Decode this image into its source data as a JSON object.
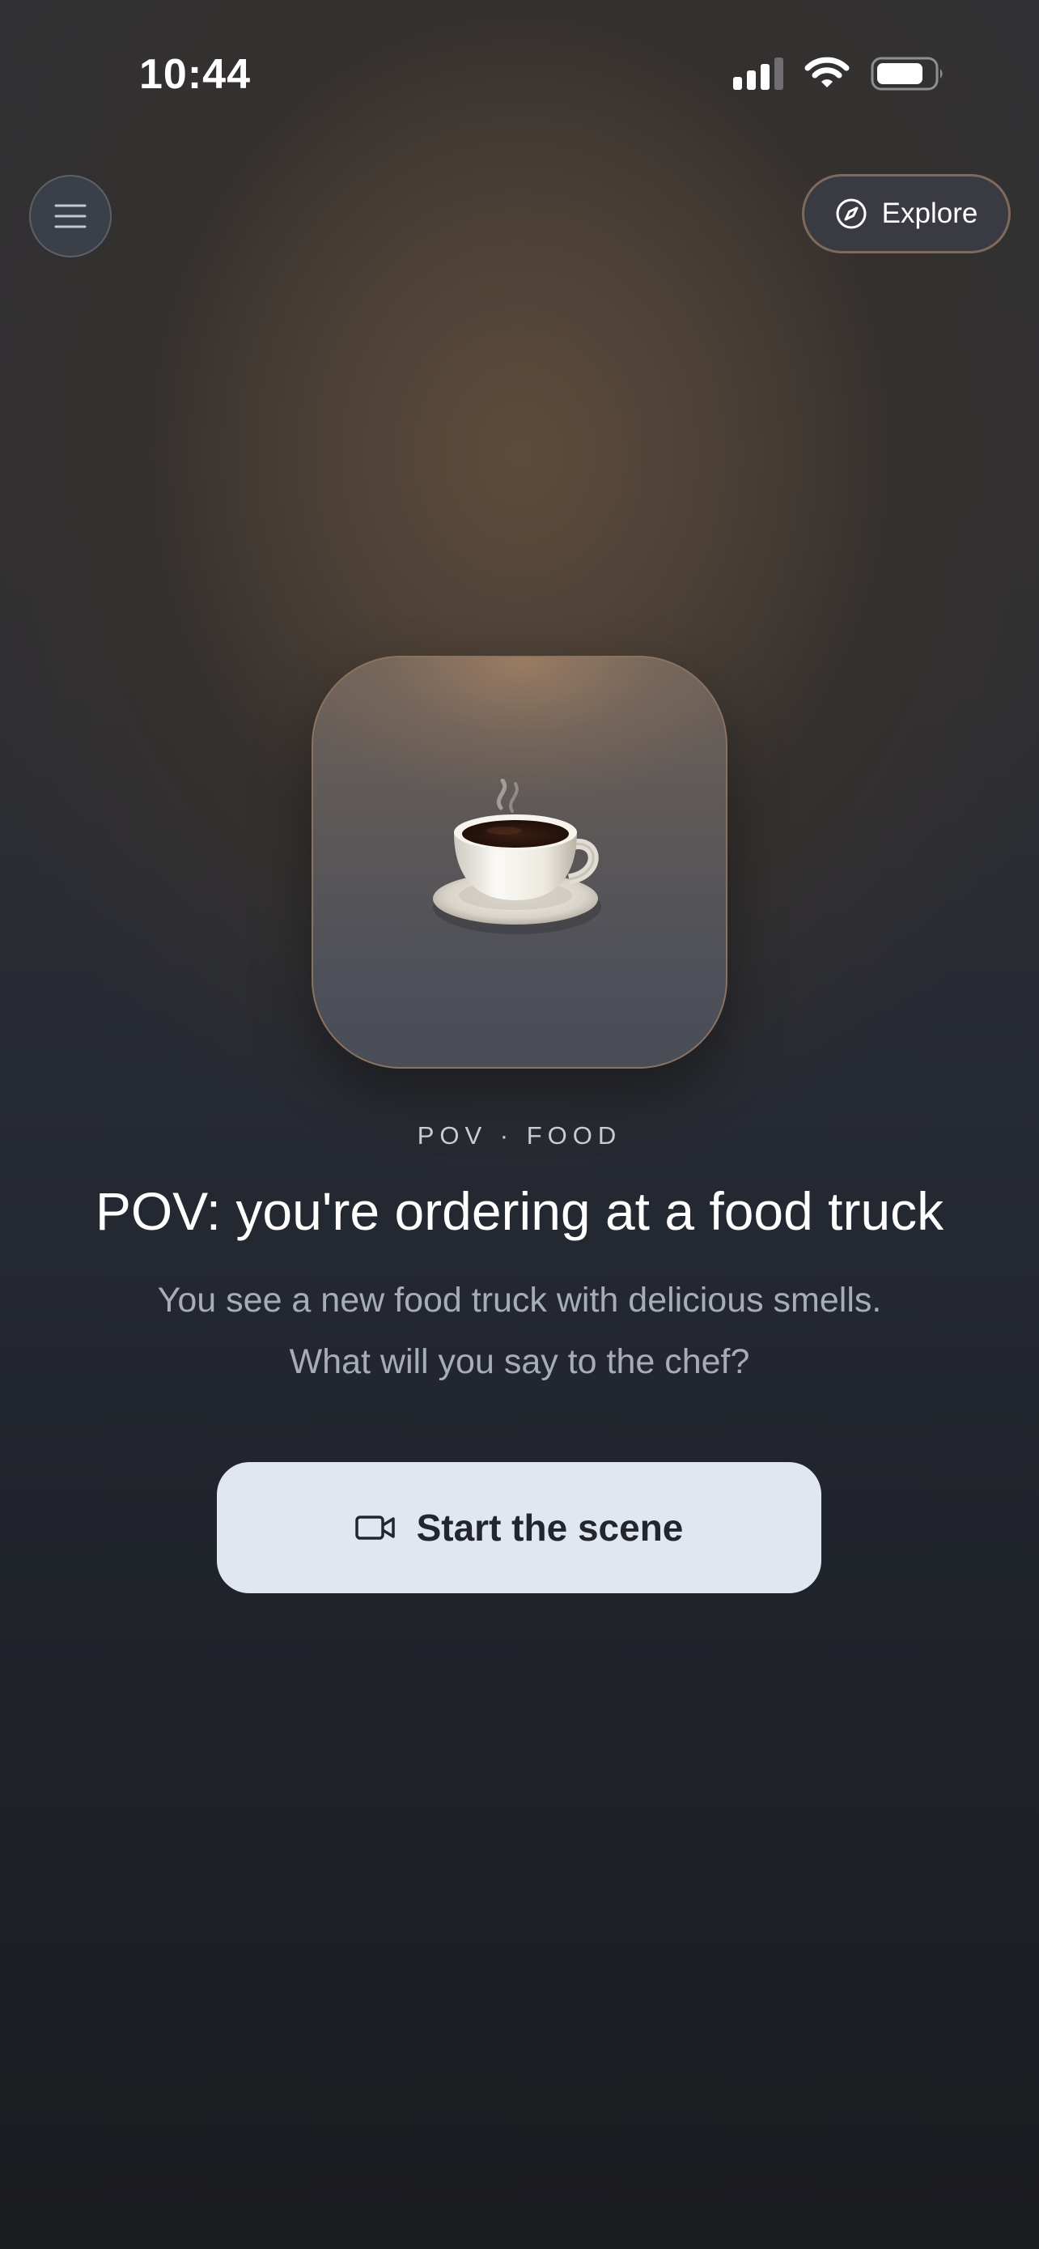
{
  "status_bar": {
    "time": "10:44"
  },
  "header": {
    "menu_icon": "hamburger-menu-icon",
    "explore_icon": "compass-icon",
    "explore_label": "Explore"
  },
  "scene": {
    "icon": "coffee-cup-icon",
    "category": "POV · FOOD",
    "title": "POV: you're ordering at a food truck",
    "description_line1": "You see a new food truck with delicious smells.",
    "description_line2": "What will you say to the chef?",
    "start_icon": "video-camera-icon",
    "start_label": "Start the scene"
  },
  "colors": {
    "button_bg": "#e1e7f0",
    "button_text": "#23262d",
    "accent_border": "#7d6a5c"
  }
}
